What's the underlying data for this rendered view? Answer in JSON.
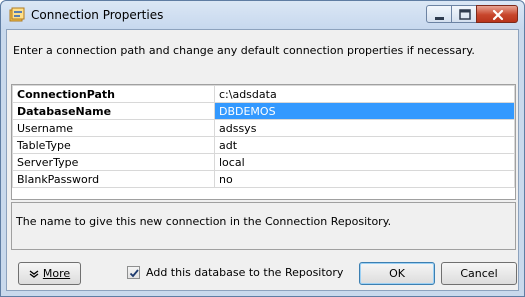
{
  "window": {
    "title": "Connection Properties"
  },
  "instruction": "Enter a connection path and change any default connection properties if necessary.",
  "properties": [
    {
      "name": "ConnectionPath",
      "value": "c:\\adsdata",
      "bold": true,
      "selected": false
    },
    {
      "name": "DatabaseName",
      "value": "DBDEMOS",
      "bold": true,
      "selected": true
    },
    {
      "name": "Username",
      "value": "adssys",
      "bold": false,
      "selected": false
    },
    {
      "name": "TableType",
      "value": "adt",
      "bold": false,
      "selected": false
    },
    {
      "name": "ServerType",
      "value": "local",
      "bold": false,
      "selected": false
    },
    {
      "name": "BlankPassword",
      "value": "no",
      "bold": false,
      "selected": false
    }
  ],
  "description": "The name to give this new connection in the Connection Repository.",
  "buttons": {
    "more_prefix": "More",
    "ok": "OK",
    "cancel": "Cancel"
  },
  "checkbox": {
    "label": "Add this database to the Repository",
    "checked": true
  },
  "colors": {
    "selection": "#3399ff",
    "titlebar": "#c9d9ec"
  },
  "icons": {
    "app": "connection-properties-icon",
    "minimize": "minimize-icon",
    "maximize": "maximize-icon",
    "close": "close-icon",
    "more": "chevron-down-icon",
    "check": "checkmark-icon"
  }
}
